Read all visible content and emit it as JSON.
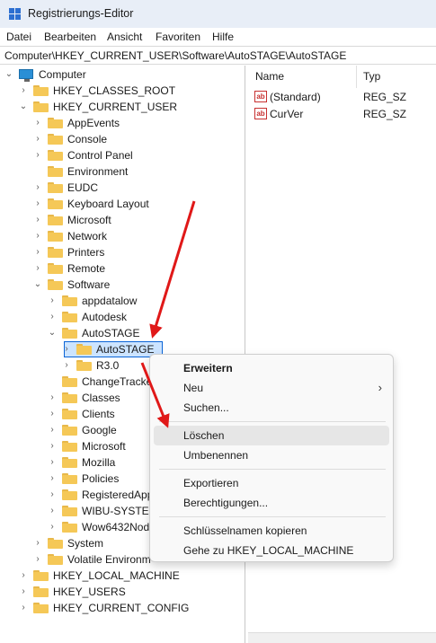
{
  "window": {
    "title": "Registrierungs-Editor"
  },
  "menu": [
    "Datei",
    "Bearbeiten",
    "Ansicht",
    "Favoriten",
    "Hilfe"
  ],
  "address": "Computer\\HKEY_CURRENT_USER\\Software\\AutoSTAGE\\AutoSTAGE",
  "tree": [
    {
      "label": "Computer",
      "chevron": "v",
      "icon": "computer",
      "selected": false
    },
    {
      "label": "HKEY_CLASSES_ROOT",
      "chevron": ">",
      "icon": "folder",
      "selected": false
    },
    {
      "label": "HKEY_CURRENT_USER",
      "chevron": "v",
      "icon": "folder",
      "selected": false
    },
    {
      "label": "AppEvents",
      "chevron": ">",
      "icon": "folder",
      "selected": false
    },
    {
      "label": "Console",
      "chevron": ">",
      "icon": "folder",
      "selected": false
    },
    {
      "label": "Control Panel",
      "chevron": ">",
      "icon": "folder",
      "selected": false
    },
    {
      "label": "Environment",
      "chevron": "",
      "icon": "folder",
      "selected": false
    },
    {
      "label": "EUDC",
      "chevron": ">",
      "icon": "folder",
      "selected": false
    },
    {
      "label": "Keyboard Layout",
      "chevron": ">",
      "icon": "folder",
      "selected": false
    },
    {
      "label": "Microsoft",
      "chevron": ">",
      "icon": "folder",
      "selected": false
    },
    {
      "label": "Network",
      "chevron": ">",
      "icon": "folder",
      "selected": false
    },
    {
      "label": "Printers",
      "chevron": ">",
      "icon": "folder",
      "selected": false
    },
    {
      "label": "Remote",
      "chevron": ">",
      "icon": "folder",
      "selected": false
    },
    {
      "label": "Software",
      "chevron": "v",
      "icon": "folder",
      "selected": false
    },
    {
      "label": "appdatalow",
      "chevron": ">",
      "icon": "folder",
      "selected": false
    },
    {
      "label": "Autodesk",
      "chevron": ">",
      "icon": "folder",
      "selected": false
    },
    {
      "label": "AutoSTAGE",
      "chevron": "v",
      "icon": "folder",
      "selected": false
    },
    {
      "label": "AutoSTAGE",
      "chevron": ">",
      "icon": "folder",
      "selected": true
    },
    {
      "label": "R3.0",
      "chevron": ">",
      "icon": "folder",
      "selected": false
    },
    {
      "label": "ChangeTracke",
      "chevron": "",
      "icon": "folder",
      "selected": false
    },
    {
      "label": "Classes",
      "chevron": ">",
      "icon": "folder",
      "selected": false
    },
    {
      "label": "Clients",
      "chevron": ">",
      "icon": "folder",
      "selected": false
    },
    {
      "label": "Google",
      "chevron": ">",
      "icon": "folder",
      "selected": false
    },
    {
      "label": "Microsoft",
      "chevron": ">",
      "icon": "folder",
      "selected": false
    },
    {
      "label": "Mozilla",
      "chevron": ">",
      "icon": "folder",
      "selected": false
    },
    {
      "label": "Policies",
      "chevron": ">",
      "icon": "folder",
      "selected": false
    },
    {
      "label": "RegisteredApp",
      "chevron": ">",
      "icon": "folder",
      "selected": false
    },
    {
      "label": "WIBU-SYSTEM",
      "chevron": ">",
      "icon": "folder",
      "selected": false
    },
    {
      "label": "Wow6432Nod",
      "chevron": ">",
      "icon": "folder",
      "selected": false
    },
    {
      "label": "System",
      "chevron": ">",
      "icon": "folder",
      "selected": false
    },
    {
      "label": "Volatile Environm",
      "chevron": ">",
      "icon": "folder",
      "selected": false
    },
    {
      "label": "HKEY_LOCAL_MACHINE",
      "chevron": ">",
      "icon": "folder",
      "selected": false
    },
    {
      "label": "HKEY_USERS",
      "chevron": ">",
      "icon": "folder",
      "selected": false
    },
    {
      "label": "HKEY_CURRENT_CONFIG",
      "chevron": ">",
      "icon": "folder",
      "selected": false
    }
  ],
  "list": {
    "headers": {
      "name": "Name",
      "type": "Typ"
    },
    "rows": [
      {
        "icon": "ab",
        "name": "(Standard)",
        "type": "REG_SZ"
      },
      {
        "icon": "ab",
        "name": "CurVer",
        "type": "REG_SZ"
      }
    ]
  },
  "context_menu": {
    "items": [
      {
        "label": "Erweitern",
        "bold": true,
        "submenu": false,
        "highlight": false
      },
      {
        "label": "Neu",
        "bold": false,
        "submenu": true,
        "highlight": false
      },
      {
        "label": "Suchen...",
        "bold": false,
        "submenu": false,
        "highlight": false
      },
      {
        "label": "Löschen",
        "bold": false,
        "submenu": false,
        "highlight": true
      },
      {
        "label": "Umbenennen",
        "bold": false,
        "submenu": false,
        "highlight": false
      },
      {
        "label": "Exportieren",
        "bold": false,
        "submenu": false,
        "highlight": false
      },
      {
        "label": "Berechtigungen...",
        "bold": false,
        "submenu": false,
        "highlight": false
      },
      {
        "label": "Schlüsselnamen kopieren",
        "bold": false,
        "submenu": false,
        "highlight": false
      },
      {
        "label": "Gehe zu HKEY_LOCAL_MACHINE",
        "bold": false,
        "submenu": false,
        "highlight": false
      }
    ]
  },
  "colors": {
    "annotation_arrow": "#e01818",
    "selection": "#cce4ff",
    "folder": "#f5c857"
  },
  "icons": {
    "app": "registry-editor-icon",
    "submenu": "chevron-right-icon"
  }
}
